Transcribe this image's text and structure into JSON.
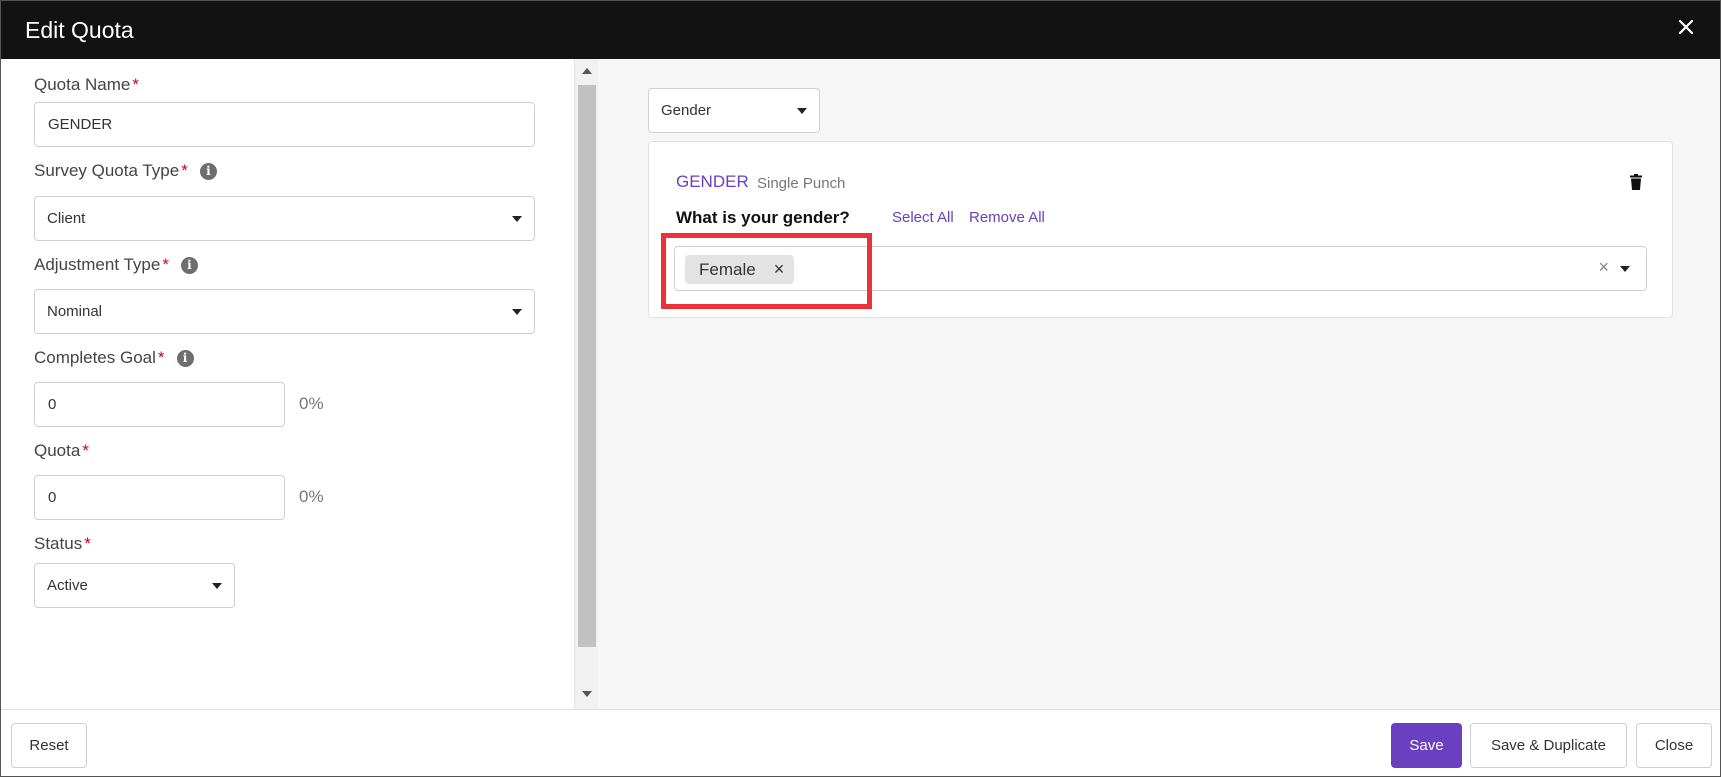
{
  "header": {
    "title": "Edit Quota"
  },
  "form": {
    "quota_name": {
      "label": "Quota Name",
      "required_mark": "*",
      "value": "GENDER"
    },
    "survey_quota_type": {
      "label": "Survey Quota Type",
      "required_mark": "*",
      "value": "Client",
      "info_icon": "info-icon"
    },
    "adjustment_type": {
      "label": "Adjustment Type",
      "required_mark": "*",
      "value": "Nominal",
      "info_icon": "info-icon"
    },
    "completes_goal": {
      "label": "Completes Goal",
      "required_mark": "*",
      "value": "0",
      "percent": "0%",
      "info_icon": "info-icon"
    },
    "quota": {
      "label": "Quota",
      "required_mark": "*",
      "value": "0",
      "percent": "0%"
    },
    "status": {
      "label": "Status",
      "required_mark": "*",
      "value": "Active"
    }
  },
  "right": {
    "variable_select": "Gender",
    "question": {
      "code": "GENDER",
      "type": "Single Punch",
      "text": "What is your gender?",
      "select_all": "Select All",
      "remove_all": "Remove All",
      "selected": [
        {
          "label": "Female",
          "remove": "×"
        }
      ],
      "clear": "×"
    }
  },
  "footer": {
    "reset": "Reset",
    "save": "Save",
    "save_duplicate": "Save & Duplicate",
    "close": "Close"
  },
  "colors": {
    "accent": "#6a3fc0",
    "header_bg": "#121212",
    "highlight": "#e8333a",
    "required": "#d0021b"
  }
}
